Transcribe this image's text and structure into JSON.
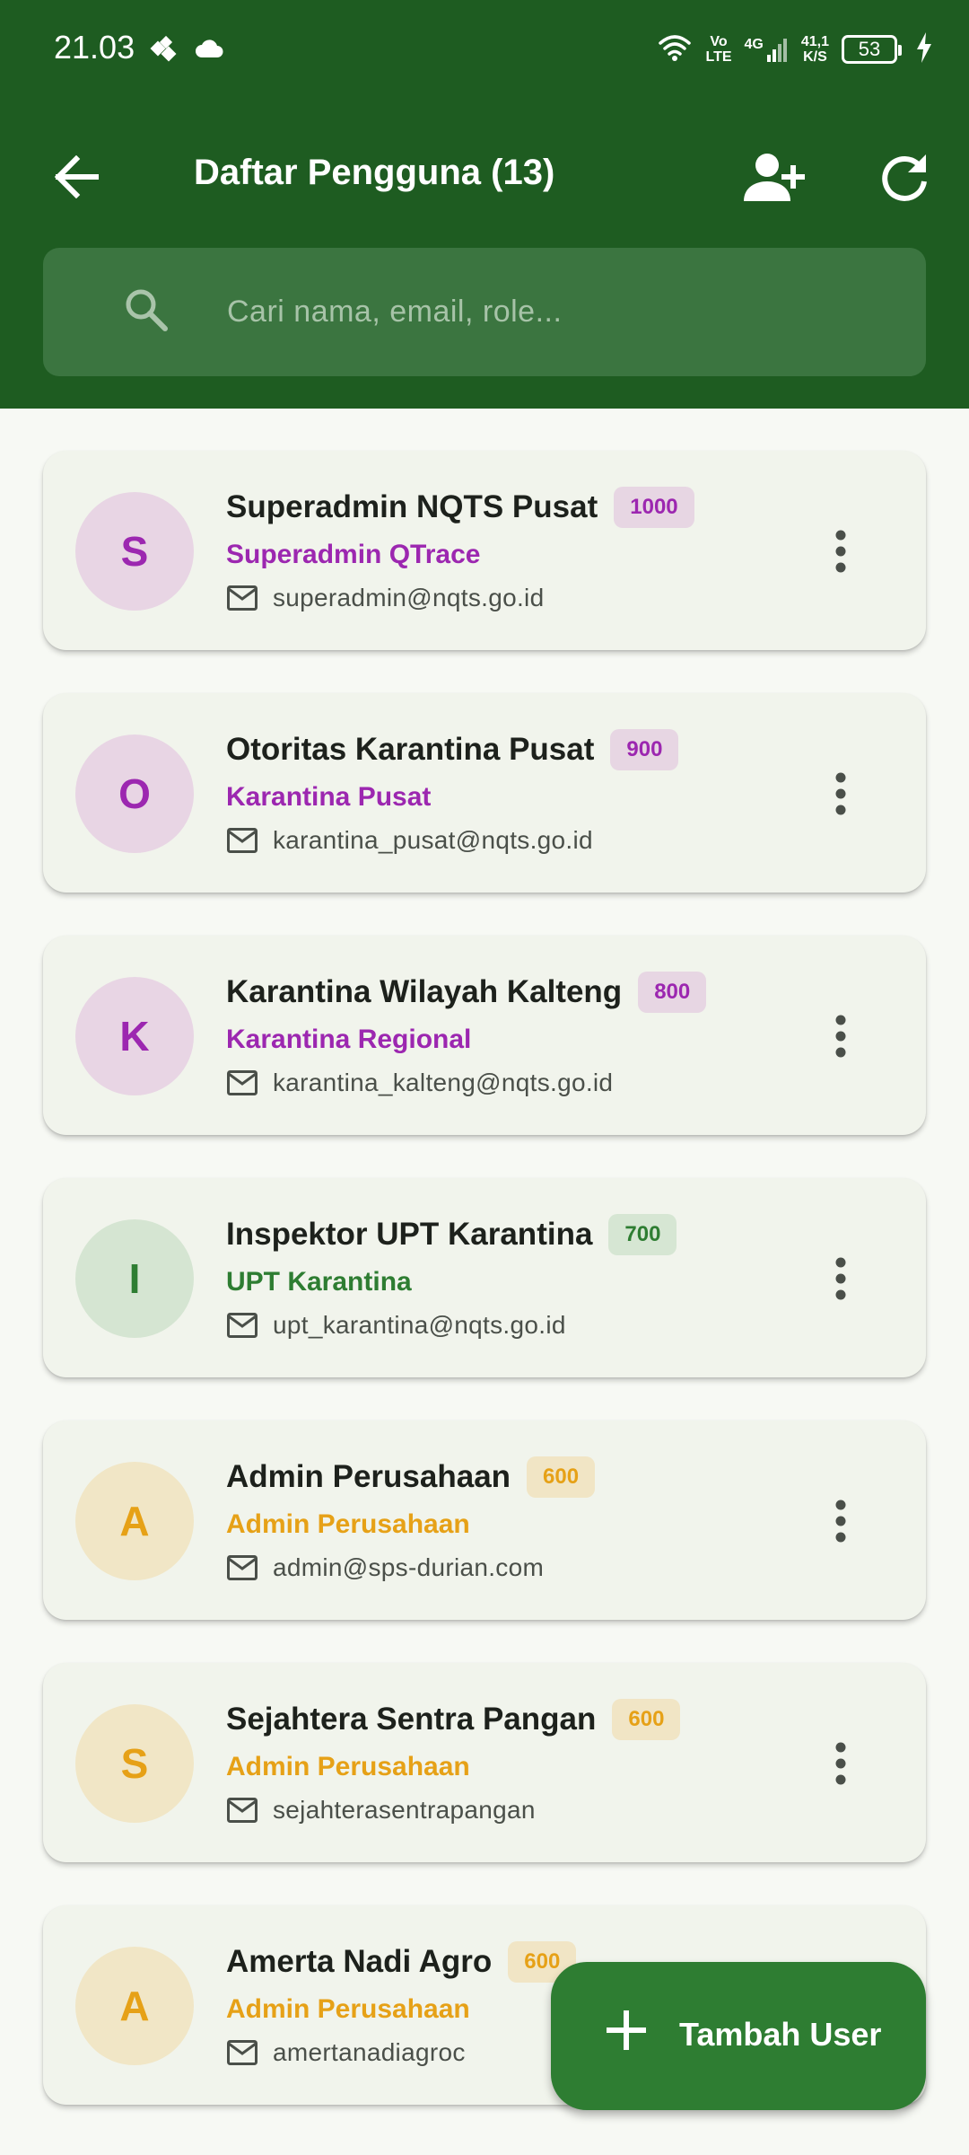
{
  "status_bar": {
    "time": "21.03",
    "network_labels": [
      "Vo",
      "LTE"
    ],
    "signal_label": "4G",
    "speed": [
      "41,1",
      "K/S"
    ],
    "battery": "53",
    "icons": [
      "app-icon",
      "cloud-icon",
      "wifi-icon",
      "signal-icon",
      "battery-icon",
      "charging-icon"
    ]
  },
  "app_bar": {
    "title": "Daftar Pengguna (13)",
    "icons": [
      "arrow-back-icon",
      "person-add-icon",
      "refresh-icon"
    ]
  },
  "search": {
    "placeholder": "Cari nama, email, role...",
    "value": ""
  },
  "users": [
    {
      "initial": "S",
      "name": "Superadmin NQTS Pusat",
      "level": "1000",
      "role": "Superadmin QTrace",
      "email": "superadmin@nqts.go.id",
      "color": "#9c27b0",
      "tint": "#e8d5e4",
      "badge_bg": "#e7d6e3"
    },
    {
      "initial": "O",
      "name": "Otoritas Karantina Pusat",
      "level": "900",
      "role": "Karantina Pusat",
      "email": "karantina_pusat@nqts.go.id",
      "color": "#9c27b0",
      "tint": "#e8d5e4",
      "badge_bg": "#e7d6e3"
    },
    {
      "initial": "K",
      "name": "Karantina Wilayah Kalteng",
      "level": "800",
      "role": "Karantina Regional",
      "email": "karantina_kalteng@nqts.go.id",
      "color": "#9c27b0",
      "tint": "#e8d5e4",
      "badge_bg": "#e7d6e3"
    },
    {
      "initial": "I",
      "name": "Inspektor UPT Karantina",
      "level": "700",
      "role": "UPT Karantina",
      "email": "upt_karantina@nqts.go.id",
      "color": "#2e7d32",
      "tint": "#d5e5d2",
      "badge_bg": "#d6e6d3"
    },
    {
      "initial": "A",
      "name": "Admin Perusahaan",
      "level": "600",
      "role": "Admin Perusahaan",
      "email": "admin@sps-durian.com",
      "color": "#e6a117",
      "tint": "#f1e6c6",
      "badge_bg": "#f1e5c5"
    },
    {
      "initial": "S",
      "name": "Sejahtera Sentra Pangan",
      "level": "600",
      "role": "Admin Perusahaan",
      "email": "sejahterasentrapangan",
      "color": "#e6a117",
      "tint": "#f1e6c6",
      "badge_bg": "#f1e5c5"
    },
    {
      "initial": "A",
      "name": "Amerta Nadi Agro",
      "level": "600",
      "role": "Admin Perusahaan",
      "email": "amertanadiagroc",
      "color": "#e6a117",
      "tint": "#f1e6c6",
      "badge_bg": "#f1e5c5"
    }
  ],
  "fab": {
    "label": "Tambah User",
    "icon": "plus-icon"
  }
}
